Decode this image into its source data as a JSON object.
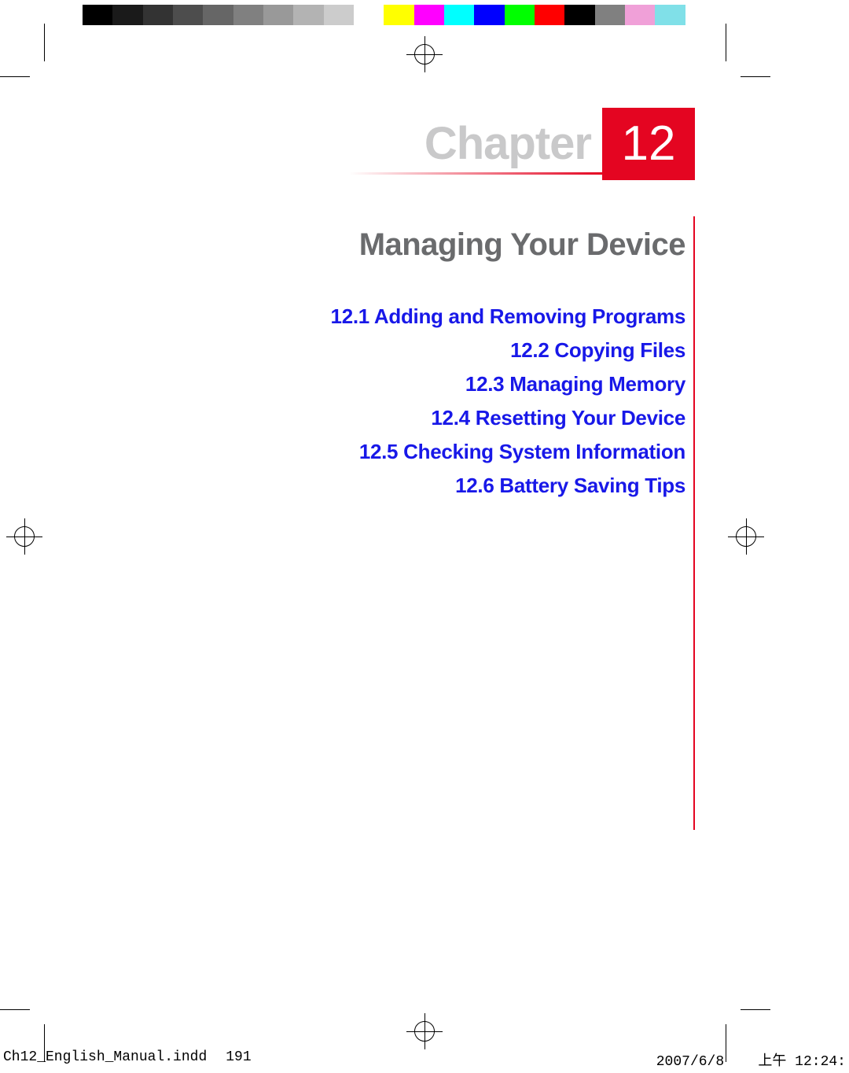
{
  "calibration_colors": [
    "#000000",
    "#1a1a1a",
    "#333333",
    "#4d4d4d",
    "#666666",
    "#808080",
    "#999999",
    "#b3b3b3",
    "#cccccc",
    "#ffffff",
    "#ffff00",
    "#ff00ff",
    "#00ffff",
    "#0000ff",
    "#00ff00",
    "#ff0000",
    "#000000",
    "#808080",
    "#f0a0d8",
    "#80e0e8",
    "#ffffff"
  ],
  "chapter": {
    "word": "Chapter",
    "number": "12",
    "title": "Managing Your Device"
  },
  "toc": [
    "12.1  Adding and Removing Programs",
    "12.2  Copying Files",
    "12.3  Managing Memory",
    "12.4  Resetting Your Device",
    "12.5  Checking System Information",
    "12.6  Battery Saving Tips"
  ],
  "slug": {
    "file": "Ch12_English_Manual.indd",
    "page": "191",
    "date": "2007/6/8",
    "time": "上午 12:24:"
  }
}
